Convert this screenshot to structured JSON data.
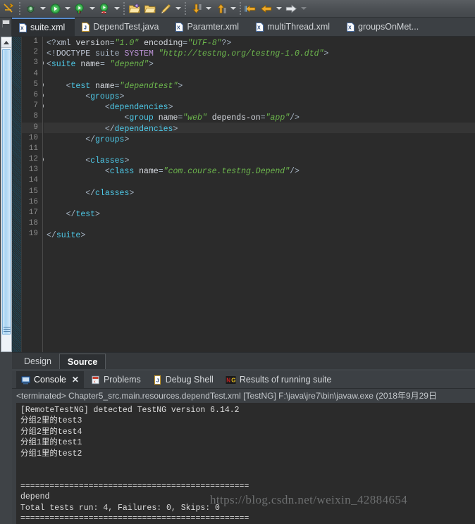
{
  "toolbar": {
    "buttons": [
      {
        "name": "skip-all-breakpoints-icon",
        "label": "Skip All Breakpoints"
      },
      {
        "name": "debug-icon",
        "label": "Debug"
      },
      {
        "name": "run-icon",
        "label": "Run"
      },
      {
        "name": "run-coverage-icon",
        "label": "Coverage"
      },
      {
        "name": "run-last-tool-icon",
        "label": "External Tools"
      },
      {
        "name": "new-java-package-icon",
        "label": "New Java Package"
      },
      {
        "name": "open-type-icon",
        "label": "Open Type"
      },
      {
        "name": "pencil-edit-icon",
        "label": "Edit"
      },
      {
        "name": "next-annotation-icon",
        "label": "Next Annotation"
      },
      {
        "name": "previous-annotation-icon",
        "label": "Previous Annotation"
      },
      {
        "name": "back-history-icon",
        "label": "Back"
      },
      {
        "name": "back-arrow-icon",
        "label": "Backward"
      },
      {
        "name": "forward-arrow-icon",
        "label": "Forward"
      }
    ]
  },
  "editor_tabs": [
    {
      "label": "suite.xml",
      "icon": "xml-file-icon",
      "active": true
    },
    {
      "label": "DependTest.java",
      "icon": "java-file-icon",
      "active": false
    },
    {
      "label": "Paramter.xml",
      "icon": "xml-file-icon",
      "active": false
    },
    {
      "label": "multiThread.xml",
      "icon": "xml-file-icon",
      "active": false
    },
    {
      "label": "groupsOnMet...",
      "icon": "xml-file-icon",
      "active": false
    }
  ],
  "code": {
    "lines": [
      {
        "n": 1,
        "fold": false,
        "hl": false
      },
      {
        "n": 2,
        "fold": false,
        "hl": false
      },
      {
        "n": 3,
        "fold": true,
        "hl": false
      },
      {
        "n": 4,
        "fold": false,
        "hl": false
      },
      {
        "n": 5,
        "fold": true,
        "hl": false
      },
      {
        "n": 6,
        "fold": true,
        "hl": false
      },
      {
        "n": 7,
        "fold": true,
        "hl": false
      },
      {
        "n": 8,
        "fold": false,
        "hl": false
      },
      {
        "n": 9,
        "fold": false,
        "hl": true
      },
      {
        "n": 10,
        "fold": false,
        "hl": false
      },
      {
        "n": 11,
        "fold": false,
        "hl": false
      },
      {
        "n": 12,
        "fold": true,
        "hl": false
      },
      {
        "n": 13,
        "fold": false,
        "hl": false
      },
      {
        "n": 14,
        "fold": false,
        "hl": false
      },
      {
        "n": 15,
        "fold": false,
        "hl": false
      },
      {
        "n": 16,
        "fold": false,
        "hl": false
      },
      {
        "n": 17,
        "fold": false,
        "hl": false
      },
      {
        "n": 18,
        "fold": false,
        "hl": false
      },
      {
        "n": 19,
        "fold": false,
        "hl": false
      }
    ],
    "text": {
      "l1": "<?xml version=\"1.0\" encoding=\"UTF-8\"?>",
      "l2": "<!DOCTYPE suite SYSTEM \"http://testng.org/testng-1.0.dtd\">",
      "l3": "<suite name= \"depend\">",
      "l5": "    <test name=\"dependtest\">",
      "l6": "        <groups>",
      "l7": "            <dependencies>",
      "l8": "                <group name=\"web\" depends-on=\"app\"/>",
      "l9": "            </dependencies>",
      "l10": "        </groups>",
      "l12": "        <classes>",
      "l13": "            <class name=\"com.course.testng.Depend\"/>",
      "l15": "        </classes>",
      "l17": "    </test>",
      "l19": "</suite>"
    }
  },
  "design_source_tabs": [
    {
      "label": "Design",
      "active": false
    },
    {
      "label": "Source",
      "active": true
    }
  ],
  "console": {
    "views": [
      {
        "label": "Console",
        "icon": "console-icon",
        "active": true,
        "closable": true
      },
      {
        "label": "Problems",
        "icon": "problems-icon",
        "active": false,
        "closable": false
      },
      {
        "label": "Debug Shell",
        "icon": "debug-shell-icon",
        "active": false,
        "closable": false
      },
      {
        "label": "Results of running suite",
        "icon": "testng-icon",
        "active": false,
        "closable": false
      }
    ],
    "terminated_line": "<terminated> Chapter5_src.main.resources.dependTest.xml [TestNG] F:\\java\\jre7\\bin\\javaw.exe (2018年9月29日",
    "output": [
      "[RemoteTestNG] detected TestNG version 6.14.2",
      "分组2里的test3",
      "分组2里的test4",
      "分组1里的test1",
      "分组1里的test2",
      "",
      "",
      "===============================================",
      "depend",
      "Total tests run: 4, Failures: 0, Skips: 0",
      "==============================================="
    ]
  },
  "watermark": "https://blog.csdn.net/weixin_42884654",
  "colors": {
    "editor_bg": "#2b2b2b",
    "chrome_bg": "#3f4347",
    "tag": "#4ec9e8",
    "string": "#6db74d",
    "accent_tab": "#5a8fd0"
  }
}
